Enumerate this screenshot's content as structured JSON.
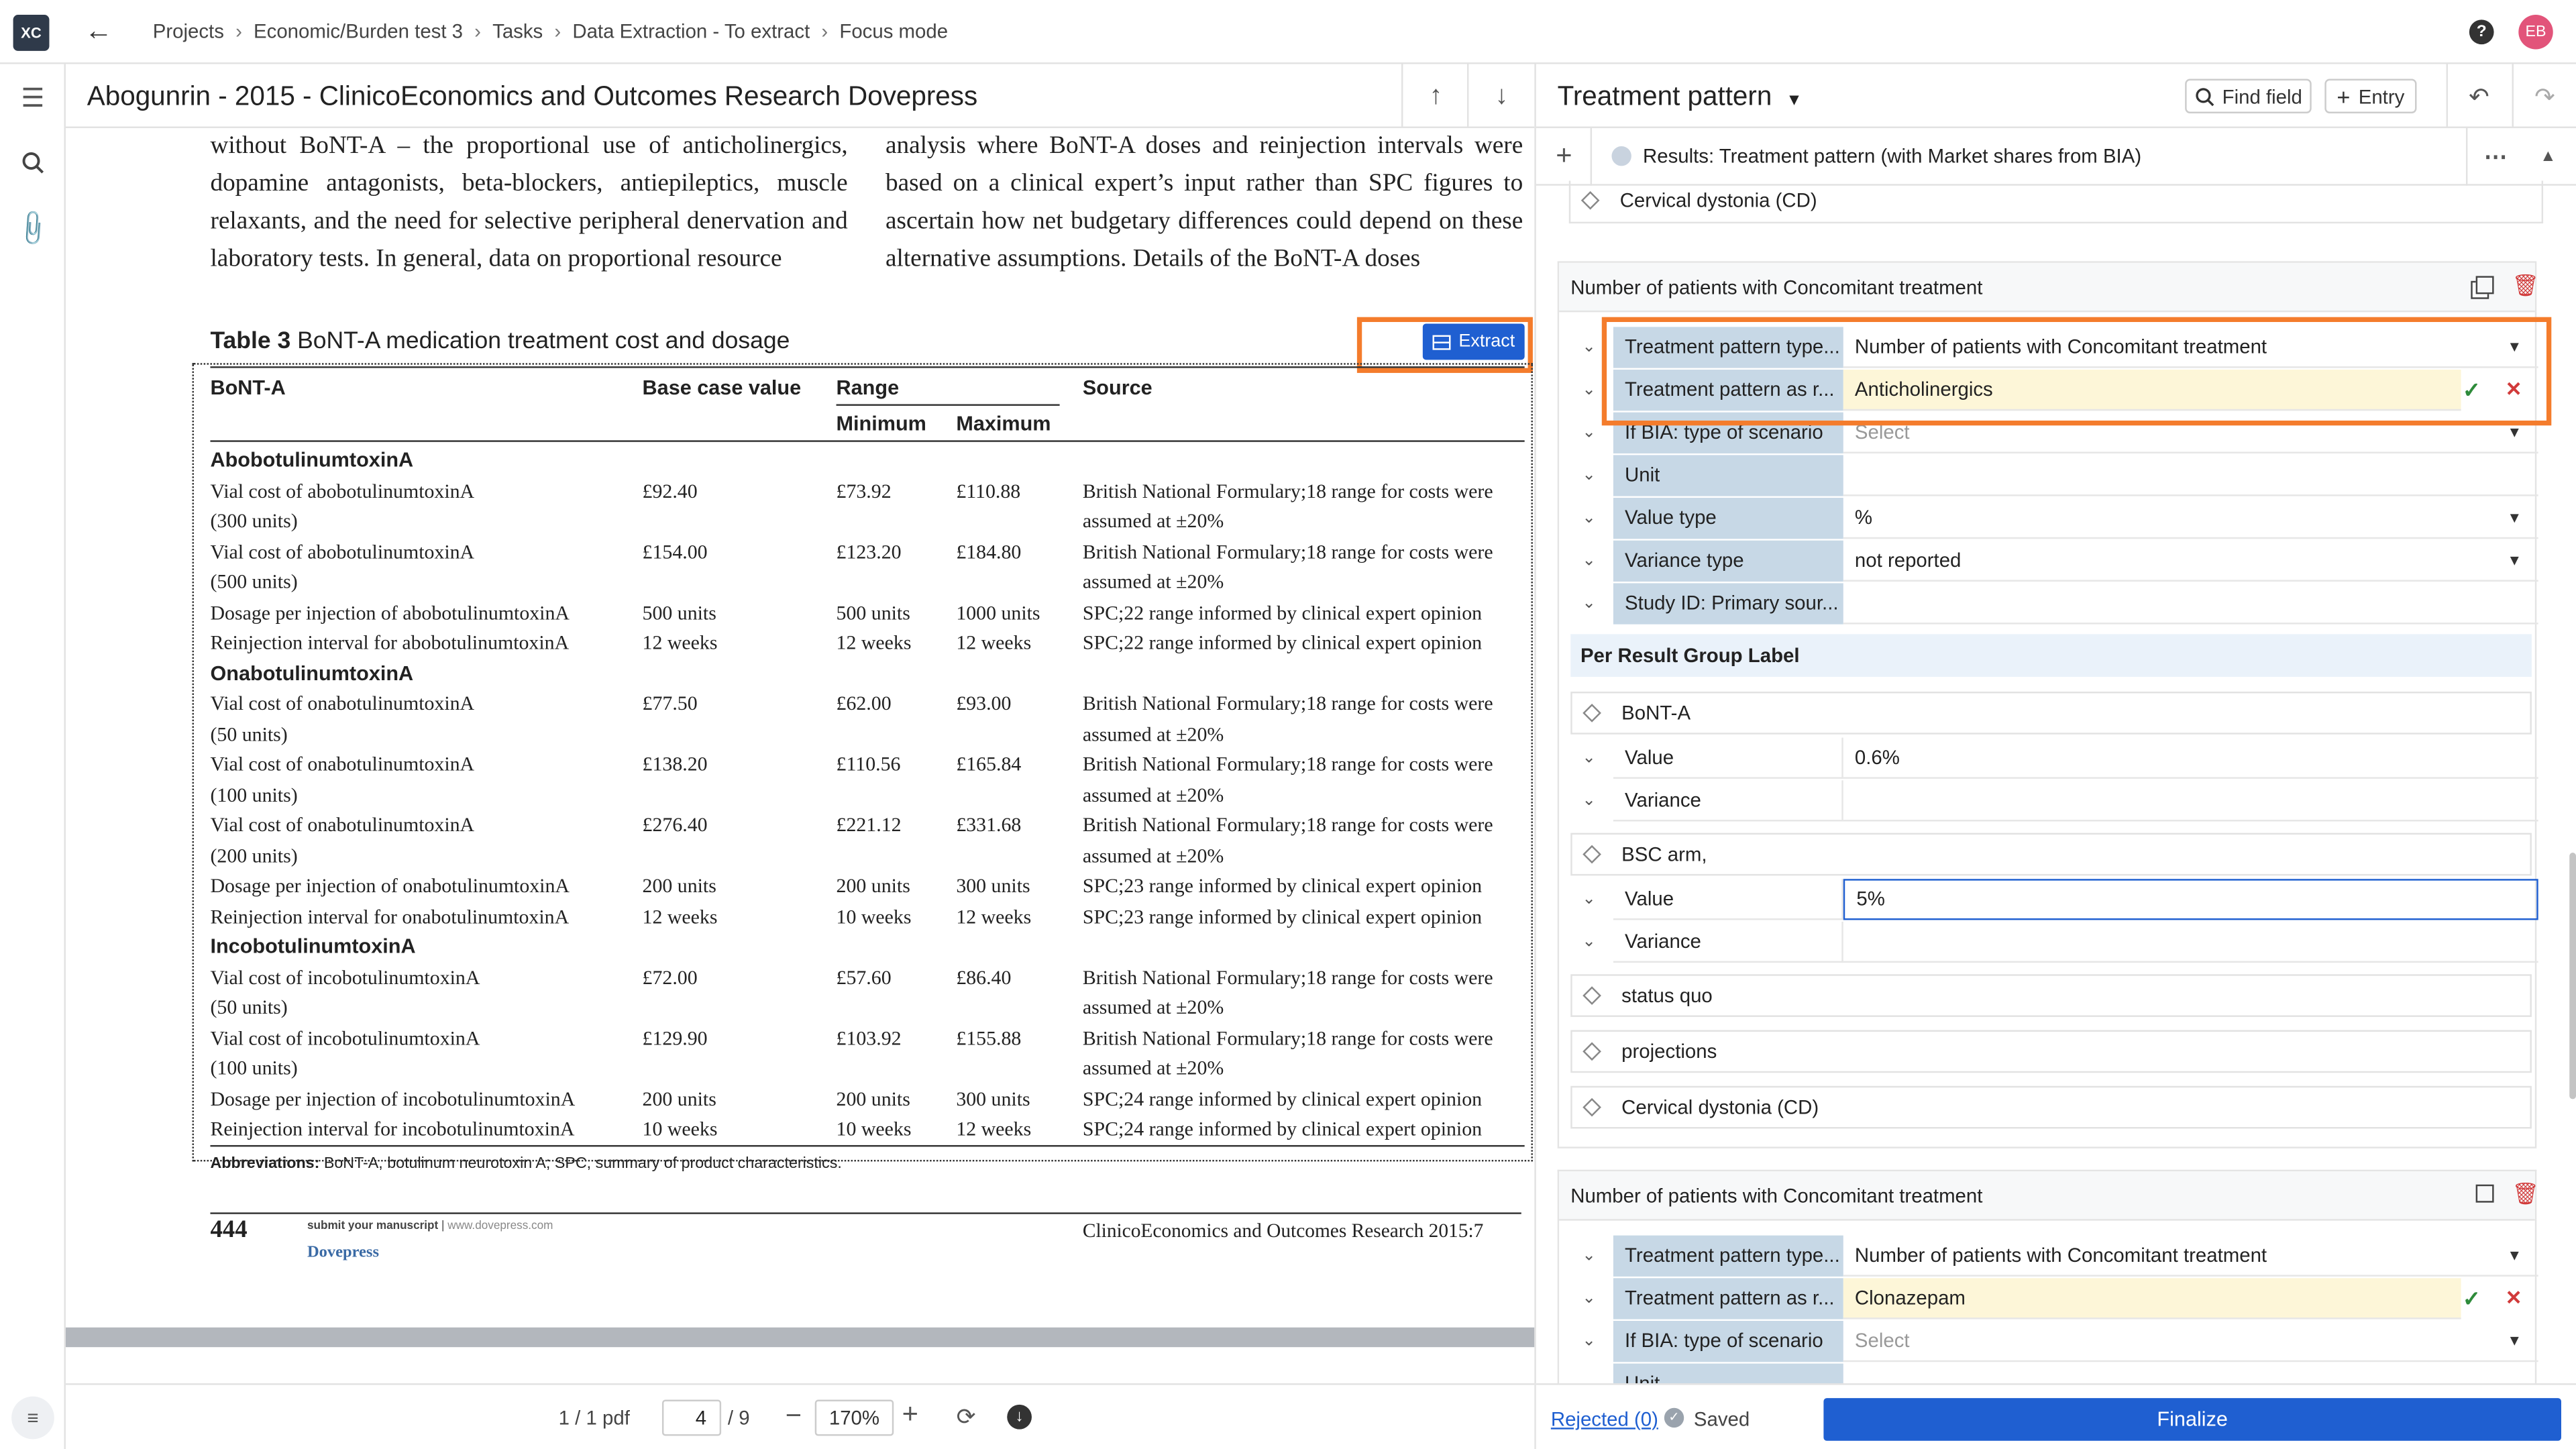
{
  "colors": {
    "accent": "#1f5fd1",
    "highlight": "#f47c2c",
    "label_bg": "#c7d8e6",
    "editing_bg": "#fdf6d8",
    "avatar": "#e2547a"
  },
  "topbar": {
    "logo": "XC",
    "breadcrumbs": [
      "Projects",
      "Economic/Burden test 3",
      "Tasks",
      "Data Extraction - To extract",
      "Focus mode"
    ],
    "avatar": "EB",
    "help_icon": "question-icon"
  },
  "document": {
    "title": "Abogunrin - 2015 - ClinicoEconomics and Outcomes Research Dovepress",
    "left_paragraph": "without BoNT-A – the proportional use of anticholinergics, dopamine antagonists, beta-blockers, antiepileptics, muscle relaxants, and the need for selective peripheral denervation and laboratory tests. In general, data on proportional resource",
    "right_paragraph": "analysis where BoNT-A doses and reinjection intervals were based on a clinical expert’s input rather than SPC figures to ascertain how net budgetary differences could depend on these alternative assumptions. Details of the BoNT-A doses",
    "table_caption_bold": "Table 3",
    "table_caption": "BoNT-A medication treatment cost and dosage",
    "extract_label": "Extract",
    "headers": {
      "c1": "BoNT-A",
      "c2": "Base case value",
      "c3": "Range",
      "c3a": "Minimum",
      "c3b": "Maximum",
      "c4": "Source"
    },
    "rows": [
      {
        "a": "AbobotulinumtoxinA",
        "group": true
      },
      {
        "a": "Vial cost of abobotulinumtoxinA",
        "b": "£92.40",
        "c": "£73.92",
        "d": "£110.88",
        "e": "British National Formulary;18 range for costs were"
      },
      {
        "a": "(300 units)",
        "e": "assumed at ±20%"
      },
      {
        "a": "Vial cost of abobotulinumtoxinA",
        "b": "£154.00",
        "c": "£123.20",
        "d": "£184.80",
        "e": "British National Formulary;18 range for costs were"
      },
      {
        "a": "(500 units)",
        "e": "assumed at ±20%"
      },
      {
        "a": "Dosage per injection of abobotulinumtoxinA",
        "b": "500 units",
        "c": "500 units",
        "d": "1000 units",
        "e": "SPC;22 range informed by clinical expert opinion"
      },
      {
        "a": "Reinjection interval for abobotulinumtoxinA",
        "b": "12 weeks",
        "c": "12 weeks",
        "d": "12 weeks",
        "e": "SPC;22 range informed by clinical expert opinion"
      },
      {
        "a": "OnabotulinumtoxinA",
        "group": true
      },
      {
        "a": "Vial cost of onabotulinumtoxinA",
        "b": "£77.50",
        "c": "£62.00",
        "d": "£93.00",
        "e": "British National Formulary;18 range for costs were"
      },
      {
        "a": "(50 units)",
        "e": "assumed at ±20%"
      },
      {
        "a": "Vial cost of onabotulinumtoxinA",
        "b": "£138.20",
        "c": "£110.56",
        "d": "£165.84",
        "e": "British National Formulary;18 range for costs were"
      },
      {
        "a": "(100 units)",
        "e": "assumed at ±20%"
      },
      {
        "a": "Vial cost of onabotulinumtoxinA",
        "b": "£276.40",
        "c": "£221.12",
        "d": "£331.68",
        "e": "British National Formulary;18 range for costs were"
      },
      {
        "a": "(200 units)",
        "e": "assumed at ±20%"
      },
      {
        "a": "Dosage per injection of onabotulinumtoxinA",
        "b": "200 units",
        "c": "200 units",
        "d": "300 units",
        "e": "SPC;23 range informed by clinical expert opinion"
      },
      {
        "a": "Reinjection interval for onabotulinumtoxinA",
        "b": "12 weeks",
        "c": "10 weeks",
        "d": "12 weeks",
        "e": "SPC;23 range informed by clinical expert opinion"
      },
      {
        "a": "IncobotulinumtoxinA",
        "group": true
      },
      {
        "a": "Vial cost of incobotulinumtoxinA",
        "b": "£72.00",
        "c": "£57.60",
        "d": "£86.40",
        "e": "British National Formulary;18 range for costs were"
      },
      {
        "a": "(50 units)",
        "e": "assumed at ±20%"
      },
      {
        "a": "Vial cost of incobotulinumtoxinA",
        "b": "£129.90",
        "c": "£103.92",
        "d": "£155.88",
        "e": "British National Formulary;18 range for costs were"
      },
      {
        "a": "(100 units)",
        "e": "assumed at ±20%"
      },
      {
        "a": "Dosage per injection of incobotulinumtoxinA",
        "b": "200 units",
        "c": "200 units",
        "d": "300 units",
        "e": "SPC;24 range informed by clinical expert opinion"
      },
      {
        "a": "Reinjection interval for incobotulinumtoxinA",
        "b": "10 weeks",
        "c": "10 weeks",
        "d": "12 weeks",
        "e": "SPC;24 range informed by clinical expert opinion"
      }
    ],
    "abbreviations_bold": "Abbreviations:",
    "abbreviations": "BoNT-A, botulinum neurotoxin A; SPC, summary of product characteristics.",
    "page_number": "444",
    "footer_submit": "submit your manuscript",
    "footer_site": "www.dovepress.com",
    "footer_brand": "Dovepress",
    "footer_journal": "ClinicoEconomics and Outcomes Research 2015:7"
  },
  "pager": {
    "pdf_count": "1 / 1 pdf",
    "page": "4",
    "total": "/ 9",
    "zoom": "170%"
  },
  "panel": {
    "title": "Treatment pattern",
    "find_field": "Find field",
    "entry": "Entry",
    "results_label": "Results: Treatment pattern (with Market shares from BIA)",
    "top_option": "Cervical dystonia (CD)",
    "card1": {
      "title": "Number of patients with Concomitant treatment",
      "fields": [
        {
          "label": "Treatment pattern type...",
          "value": "Number of patients with Concomitant treatment",
          "dropdown": true
        },
        {
          "label": "Treatment pattern as r...",
          "value": "Anticholinergics",
          "editing": true
        },
        {
          "label": "If BIA: type of scenario",
          "value": "Select",
          "placeholder": true,
          "dropdown": true
        },
        {
          "label": "Unit",
          "value": ""
        },
        {
          "label": "Value type",
          "value": "%",
          "dropdown": true
        },
        {
          "label": "Variance type",
          "value": "not reported",
          "dropdown": true
        },
        {
          "label": "Study ID: Primary sour...",
          "value": ""
        }
      ],
      "group_label": "Per Result Group Label",
      "groups": [
        {
          "name": "BoNT-A",
          "value": "0.6%",
          "variance": ""
        },
        {
          "name": "BSC arm,",
          "value": "5%",
          "variance": ""
        }
      ],
      "options": [
        "status quo",
        "projections",
        "Cervical dystonia (CD)"
      ],
      "value_label": "Value",
      "variance_label": "Variance"
    },
    "card2": {
      "title": "Number of patients with Concomitant treatment",
      "fields": [
        {
          "label": "Treatment pattern type...",
          "value": "Number of patients with Concomitant treatment",
          "dropdown": true
        },
        {
          "label": "Treatment pattern as r...",
          "value": "Clonazepam",
          "editing": true
        },
        {
          "label": "If BIA: type of scenario",
          "value": "Select",
          "placeholder": true,
          "dropdown": true
        },
        {
          "label": "Unit",
          "value": ""
        }
      ]
    },
    "rejected": "Rejected (0)",
    "saved": "Saved",
    "finalize": "Finalize"
  }
}
